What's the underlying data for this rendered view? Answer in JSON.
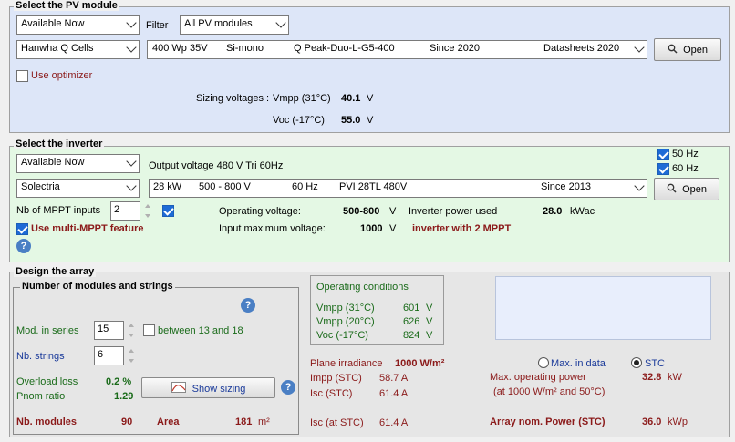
{
  "pv_module": {
    "title": "Select the PV module",
    "availability": "Available Now",
    "filter_label": "Filter",
    "filter_value": "All PV modules",
    "manufacturer": "Hanwha Q Cells",
    "model_row": {
      "power": "400 Wp 35V",
      "tech": "Si-mono",
      "model": "Q Peak-Duo-L-G5-400",
      "since": "Since 2020",
      "source": "Datasheets 2020"
    },
    "open_label": "Open",
    "use_optimizer": "Use optimizer",
    "sizing_label": "Sizing voltages :",
    "vmpp_label": "Vmpp (31°C)",
    "vmpp_value": "40.1",
    "voc_label": "Voc (-17°C)",
    "voc_value": "55.0",
    "unit_v": "V"
  },
  "inverter": {
    "title": "Select the inverter",
    "freq_50": "50 Hz",
    "freq_60": "60 Hz",
    "availability": "Available Now",
    "output_voltage": "Output voltage 480 V Tri 60Hz",
    "manufacturer": "Solectria",
    "model_row": {
      "power": "28 kW",
      "voltage": "500 - 800 V",
      "freq": "60 Hz",
      "model": "PVI 28TL 480V",
      "since": "Since 2013"
    },
    "open_label": "Open",
    "mppt_inputs_label": "Nb of MPPT inputs",
    "mppt_inputs_value": "2",
    "multi_mppt_label": "Use multi-MPPT feature",
    "op_voltage_label": "Operating voltage:",
    "op_voltage_value": "500-800",
    "input_max_label": "Input maximum voltage:",
    "input_max_value": "1000",
    "unit_v": "V",
    "power_used_label": "Inverter power used",
    "power_used_value": "28.0",
    "power_used_unit": "kWac",
    "mppt_note": "inverter with 2 MPPT"
  },
  "array": {
    "title": "Design the array",
    "strings_title": "Number of modules and strings",
    "mod_series_label": "Mod. in series",
    "mod_series_value": "15",
    "between_label": "between 13 and 18",
    "nb_strings_label": "Nb. strings",
    "nb_strings_value": "6",
    "overload_label": "Overload loss",
    "overload_value": "0.2 %",
    "pnom_label": "Pnom ratio",
    "pnom_value": "1.29",
    "show_sizing": "Show sizing",
    "nb_modules_label": "Nb. modules",
    "nb_modules_value": "90",
    "area_label": "Area",
    "area_value": "181",
    "area_unit": "m²",
    "conditions": {
      "title": "Operating conditions",
      "rows": [
        {
          "label": "Vmpp (31°C)",
          "value": "601",
          "unit": "V"
        },
        {
          "label": "Vmpp (20°C)",
          "value": "626",
          "unit": "V"
        },
        {
          "label": "Voc (-17°C)",
          "value": "824",
          "unit": "V"
        }
      ]
    },
    "plane_irr_label": "Plane irradiance",
    "plane_irr_value": "1000 W/m²",
    "impp_label": "Impp (STC)",
    "impp_value": "58.7 A",
    "isc_label": "Isc (STC)",
    "isc_value": "61.4 A",
    "isc_stc_label": "Isc (at STC)",
    "isc_stc_value": "61.4 A",
    "radio_max": "Max. in data",
    "radio_stc": "STC",
    "max_power_label": "Max. operating power",
    "max_power_sub": "(at 1000 W/m² and 50°C)",
    "max_power_value": "32.8",
    "max_power_unit": "kW",
    "nom_power_label": "Array nom. Power (STC)",
    "nom_power_value": "36.0",
    "nom_power_unit": "kWp"
  },
  "colors": {
    "module_panel_bg": "#dde6f8",
    "inverter_panel_bg": "#e4f8e4",
    "array_panel_bg": "#e6e6e6"
  }
}
